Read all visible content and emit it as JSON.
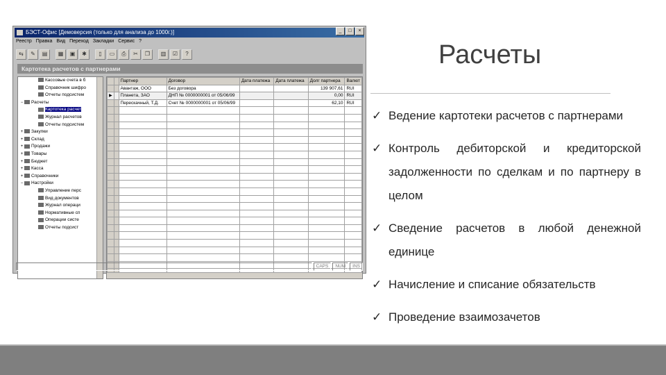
{
  "slide": {
    "title": "Расчеты",
    "bullets": [
      "Ведение картотеки расчетов с партнерами",
      "Контроль дебиторской и кредиторской задолженности по сделкам и по партнеру в целом",
      "Сведение расчетов в любой денежной единице",
      "Начисление и списание обязательств",
      "Проведение взаимозачетов"
    ]
  },
  "app": {
    "window_title": "БЭСТ-Офис [Демоверсия (только для анализа до 1000г.)]",
    "menu": [
      "Реестр",
      "Правка",
      "Вид",
      "Переход",
      "Закладки",
      "Сервис",
      "?"
    ],
    "caption": "Картотека расчетов с партнерами",
    "tree": [
      {
        "label": "Кассовые счета в б",
        "level": 2
      },
      {
        "label": "Справочник шифро",
        "level": 2
      },
      {
        "label": "Отчеты подсистем",
        "level": 2
      },
      {
        "label": "Расчеты",
        "level": 1,
        "expander": "−"
      },
      {
        "label": "Картотека расчет",
        "level": 2,
        "selected": true
      },
      {
        "label": "Журнал расчетов",
        "level": 2
      },
      {
        "label": "Отчеты подсистем",
        "level": 2
      },
      {
        "label": "Закупки",
        "level": 1,
        "expander": "+"
      },
      {
        "label": "Склад",
        "level": 1,
        "expander": "+"
      },
      {
        "label": "Продажи",
        "level": 1,
        "expander": "+"
      },
      {
        "label": "Товары",
        "level": 1,
        "expander": "+"
      },
      {
        "label": "Бюджет",
        "level": 1,
        "expander": "+"
      },
      {
        "label": "Касса",
        "level": 1,
        "expander": "+"
      },
      {
        "label": "Справочники",
        "level": 1,
        "expander": "+"
      },
      {
        "label": "Настройки",
        "level": 1,
        "expander": "−"
      },
      {
        "label": "Управление перс",
        "level": 2
      },
      {
        "label": "Вид документов",
        "level": 2
      },
      {
        "label": "Журнал операци",
        "level": 2
      },
      {
        "label": "Нормативные сп",
        "level": 2
      },
      {
        "label": "Операции систе",
        "level": 2
      },
      {
        "label": "Отчеты подсист",
        "level": 2
      }
    ],
    "grid": {
      "columns": [
        "Партнер",
        "Договор",
        "Дата платежа",
        "Дата платежа",
        "Долг партнера",
        "Валют"
      ],
      "rows": [
        [
          "Авантаж, ООО",
          "Без договора",
          "",
          "",
          "139 907,61",
          "RUI"
        ],
        [
          "Планета, ЗАО",
          "ДНП № 0000000001 от 05/06/99",
          "",
          "",
          "0,00",
          "RUI"
        ],
        [
          "Перескачный, Т.Д.",
          "Счет № 0000000001 от 05/06/99",
          "",
          "",
          "62,10",
          "RUI"
        ]
      ],
      "current_row": 1,
      "empty_rows": 24
    },
    "status": [
      "CAPS",
      "NUM",
      "INS"
    ]
  }
}
